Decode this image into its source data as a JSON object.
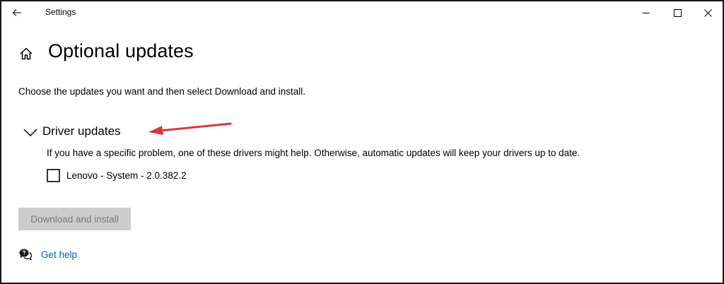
{
  "window": {
    "title": "Settings",
    "controls": {
      "minimize_icon": "minimize-icon",
      "maximize_icon": "maximize-icon",
      "close_icon": "close-icon"
    }
  },
  "page": {
    "title": "Optional updates",
    "intro": "Choose the updates you want and then select Download and install."
  },
  "driver_section": {
    "title": "Driver updates",
    "expanded": true,
    "description": "If you have a specific problem, one of these drivers might help. Otherwise, automatic updates will keep your drivers up to date.",
    "items": [
      {
        "label": "Lenovo - System - 2.0.382.2",
        "checked": false
      }
    ]
  },
  "actions": {
    "download_label": "Download and install",
    "download_enabled": false
  },
  "help": {
    "label": "Get help"
  },
  "colors": {
    "link": "#0063b1",
    "annotation_arrow": "#d9383a",
    "disabled_button_bg": "#cccccc",
    "disabled_button_text": "#7a7a7a"
  }
}
